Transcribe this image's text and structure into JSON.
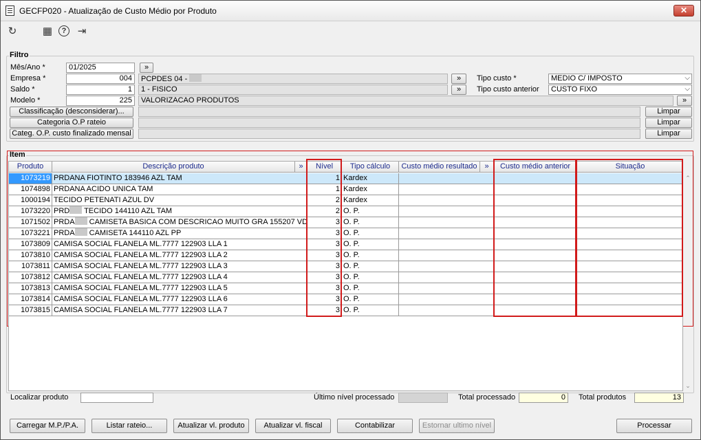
{
  "window": {
    "title": "GECFP020 - Atualização de Custo Médio por Produto",
    "close": "✕"
  },
  "toolbar": {
    "refresh_icon": "↻",
    "calendar_icon": "▦",
    "help_icon": "?",
    "exit_icon": "⇥"
  },
  "filtro": {
    "legend": "Filtro",
    "mes_ano": {
      "label": "Mês/Ano *",
      "value": "01/2025",
      "btn": "»"
    },
    "empresa": {
      "label": "Empresa *",
      "value": "004",
      "desc": "PCPDES 04 - ",
      "btn": "»"
    },
    "saldo": {
      "label": "Saldo *",
      "value": "1",
      "desc": "1 - FISICO",
      "btn": "»"
    },
    "modelo": {
      "label": "Modelo *",
      "value": "225",
      "desc": "VALORIZACAO PRODUTOS",
      "btn": "»"
    },
    "tipo_custo": {
      "label": "Tipo custo *",
      "value": "MEDIO C/ IMPOSTO"
    },
    "tipo_custo_anterior": {
      "label": "Tipo custo anterior",
      "value": "CUSTO FIXO"
    },
    "classificacao": "Classificação (desconsiderar)...",
    "categoria": "Categoria O.P rateio",
    "categ_op": "Categ. O.P. custo finalizado mensal",
    "limpar": "Limpar"
  },
  "item": {
    "legend": "Item",
    "columns": [
      "Produto",
      "Descrição produto",
      "»",
      "Nível",
      "Tipo cálculo",
      "Custo médio resultado",
      "»",
      "Custo médio anterior",
      "Situação"
    ],
    "rows": [
      {
        "produto": "1073219",
        "descricao": "PRDANA FIOTINTO 183946 AZL TAM",
        "nivel": "1",
        "tipo": "Kardex"
      },
      {
        "produto": "1074898",
        "descricao": "PRDANA ACIDO UNICA TAM",
        "nivel": "1",
        "tipo": "Kardex"
      },
      {
        "produto": "1000194",
        "descricao": "TECIDO PETENATI AZUL DV",
        "nivel": "2",
        "tipo": "Kardex"
      },
      {
        "produto": "1073220",
        "descricao_a": "PRD",
        "descricao_b": " TECIDO 144110 AZL TAM",
        "nivel": "2",
        "tipo": "O. P."
      },
      {
        "produto": "1071502",
        "descricao_a": "PRDA",
        "descricao_b": " CAMISETA BASICA COM DESCRICAO MUITO GRA 155207 VDE PP",
        "nivel": "3",
        "tipo": "O. P."
      },
      {
        "produto": "1073221",
        "descricao_a": "PRDA",
        "descricao_b": " CAMISETA 144110 AZL PP",
        "nivel": "3",
        "tipo": "O. P."
      },
      {
        "produto": "1073809",
        "descricao": "CAMISA SOCIAL FLANELA ML.7777 122903 LLA 1",
        "nivel": "3",
        "tipo": "O. P."
      },
      {
        "produto": "1073810",
        "descricao": "CAMISA SOCIAL FLANELA ML.7777 122903 LLA 2",
        "nivel": "3",
        "tipo": "O. P."
      },
      {
        "produto": "1073811",
        "descricao": "CAMISA SOCIAL FLANELA ML.7777 122903 LLA 3",
        "nivel": "3",
        "tipo": "O. P."
      },
      {
        "produto": "1073812",
        "descricao": "CAMISA SOCIAL FLANELA ML.7777 122903 LLA 4",
        "nivel": "3",
        "tipo": "O. P."
      },
      {
        "produto": "1073813",
        "descricao": "CAMISA SOCIAL FLANELA ML.7777 122903 LLA 5",
        "nivel": "3",
        "tipo": "O. P."
      },
      {
        "produto": "1073814",
        "descricao": "CAMISA SOCIAL FLANELA ML.7777 122903 LLA 6",
        "nivel": "3",
        "tipo": "O. P."
      },
      {
        "produto": "1073815",
        "descricao": "CAMISA SOCIAL FLANELA ML.7777 122903 LLA 7",
        "nivel": "3",
        "tipo": "O. P."
      }
    ]
  },
  "footer": {
    "localizar_label": "Localizar produto",
    "ultimo_nivel_label": "Último nível processado",
    "total_processado_label": "Total processado",
    "total_processado": "0",
    "total_produtos_label": "Total produtos",
    "total_produtos": "13"
  },
  "buttons": {
    "carregar": "Carregar M.P./P.A.",
    "listar": "Listar rateio...",
    "atualizar_produto": "Atualizar vl. produto",
    "atualizar_fiscal": "Atualizar vl. fiscal",
    "contabilizar": "Contabilizar",
    "estornar": "Estornar ultimo nível",
    "processar": "Processar"
  },
  "colors": {
    "selection": "#cde8fa",
    "highlight_border": "#d11a1a",
    "header_text": "#1c2a8c",
    "total_bg": "#ffffe1"
  }
}
